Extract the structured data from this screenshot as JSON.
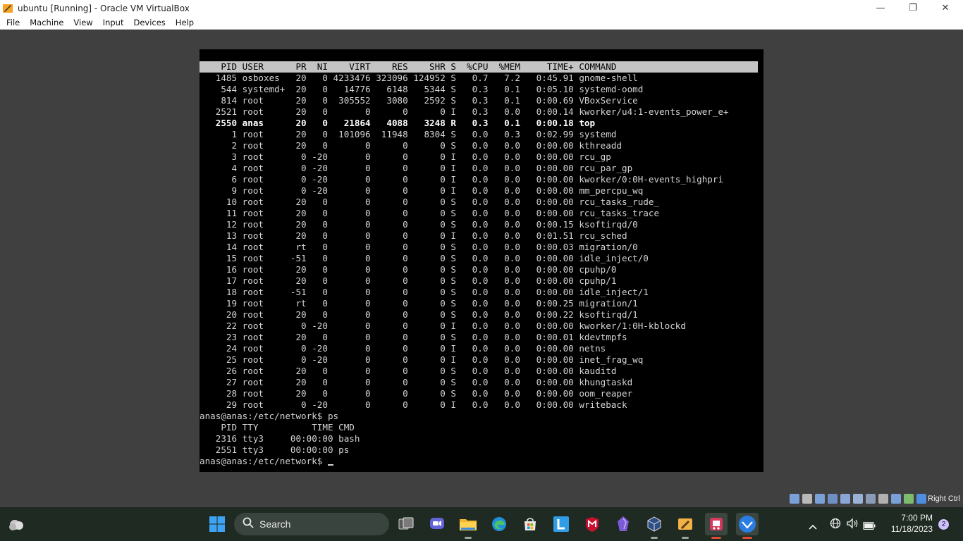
{
  "window": {
    "title": "ubuntu [Running] - Oracle VM VirtualBox",
    "minimize": "—",
    "maximize": "❐",
    "close": "✕"
  },
  "menu": [
    "File",
    "Machine",
    "View",
    "Input",
    "Devices",
    "Help"
  ],
  "terminal": {
    "lines": [
      "",
      "    PID USER      PR  NI    VIRT    RES    SHR S  %CPU  %MEM     TIME+ COMMAND",
      "   1485 osboxes   20   0 4233476 323096 124952 S   0.7   7.2   0:45.91 gnome-shell",
      "    544 systemd+  20   0   14776   6148   5344 S   0.3   0.1   0:05.10 systemd-oomd",
      "    814 root      20   0  305552   3080   2592 S   0.3   0.1   0:00.69 VBoxService",
      "   2521 root      20   0       0      0      0 I   0.3   0.0   0:00.14 kworker/u4:1-events_power_e+",
      "   2550 anas      20   0   21864   4088   3248 R   0.3   0.1   0:00.18 top",
      "      1 root      20   0  101096  11948   8304 S   0.0   0.3   0:02.99 systemd",
      "      2 root      20   0       0      0      0 S   0.0   0.0   0:00.00 kthreadd",
      "      3 root       0 -20       0      0      0 I   0.0   0.0   0:00.00 rcu_gp",
      "      4 root       0 -20       0      0      0 I   0.0   0.0   0:00.00 rcu_par_gp",
      "      6 root       0 -20       0      0      0 I   0.0   0.0   0:00.00 kworker/0:0H-events_highpri",
      "      9 root       0 -20       0      0      0 I   0.0   0.0   0:00.00 mm_percpu_wq",
      "     10 root      20   0       0      0      0 S   0.0   0.0   0:00.00 rcu_tasks_rude_",
      "     11 root      20   0       0      0      0 S   0.0   0.0   0:00.00 rcu_tasks_trace",
      "     12 root      20   0       0      0      0 S   0.0   0.0   0:00.15 ksoftirqd/0",
      "     13 root      20   0       0      0      0 I   0.0   0.0   0:01.51 rcu_sched",
      "     14 root      rt   0       0      0      0 S   0.0   0.0   0:00.03 migration/0",
      "     15 root     -51   0       0      0      0 S   0.0   0.0   0:00.00 idle_inject/0",
      "     16 root      20   0       0      0      0 S   0.0   0.0   0:00.00 cpuhp/0",
      "     17 root      20   0       0      0      0 S   0.0   0.0   0:00.00 cpuhp/1",
      "     18 root     -51   0       0      0      0 S   0.0   0.0   0:00.00 idle_inject/1",
      "     19 root      rt   0       0      0      0 S   0.0   0.0   0:00.25 migration/1",
      "     20 root      20   0       0      0      0 S   0.0   0.0   0:00.22 ksoftirqd/1",
      "     22 root       0 -20       0      0      0 I   0.0   0.0   0:00.00 kworker/1:0H-kblockd",
      "     23 root      20   0       0      0      0 S   0.0   0.0   0:00.01 kdevtmpfs",
      "     24 root       0 -20       0      0      0 I   0.0   0.0   0:00.00 netns",
      "     25 root       0 -20       0      0      0 I   0.0   0.0   0:00.00 inet_frag_wq",
      "     26 root      20   0       0      0      0 S   0.0   0.0   0:00.00 kauditd",
      "     27 root      20   0       0      0      0 S   0.0   0.0   0:00.00 khungtaskd",
      "     28 root      20   0       0      0      0 S   0.0   0.0   0:00.00 oom_reaper",
      "     29 root       0 -20       0      0      0 I   0.0   0.0   0:00.00 writeback",
      "anas@anas:/etc/network$ ps",
      "    PID TTY          TIME CMD",
      "   2316 tty3     00:00:00 bash",
      "   2551 tty3     00:00:00 ps",
      "anas@anas:/etc/network$ "
    ],
    "header_line_index": 1,
    "bold_line_index": 6,
    "cursor_line_index": 36
  },
  "vbox_status": {
    "hostkey": "Right Ctrl",
    "icons": [
      "hard-disk-icon",
      "optical-drive-icon",
      "audio-icon",
      "network-icon",
      "usb-icon",
      "shared-folders-icon",
      "display-icon",
      "video-capture-icon",
      "cpu-icon",
      "mouse-integration-icon",
      "keyboard-icon"
    ]
  },
  "taskbar": {
    "search_label": "Search",
    "apps": [
      "task-view-icon",
      "teams-chat-icon",
      "file-explorer-icon",
      "edge-icon",
      "microsoft-store-icon",
      "l-app-icon",
      "mcafee-icon",
      "obsidian-icon",
      "virtualbox-icon",
      "paint-icon",
      "snipping-tool-icon",
      "vpn-app-icon"
    ],
    "time": "7:00 PM",
    "date": "11/18/2023",
    "notification_count": "2"
  }
}
